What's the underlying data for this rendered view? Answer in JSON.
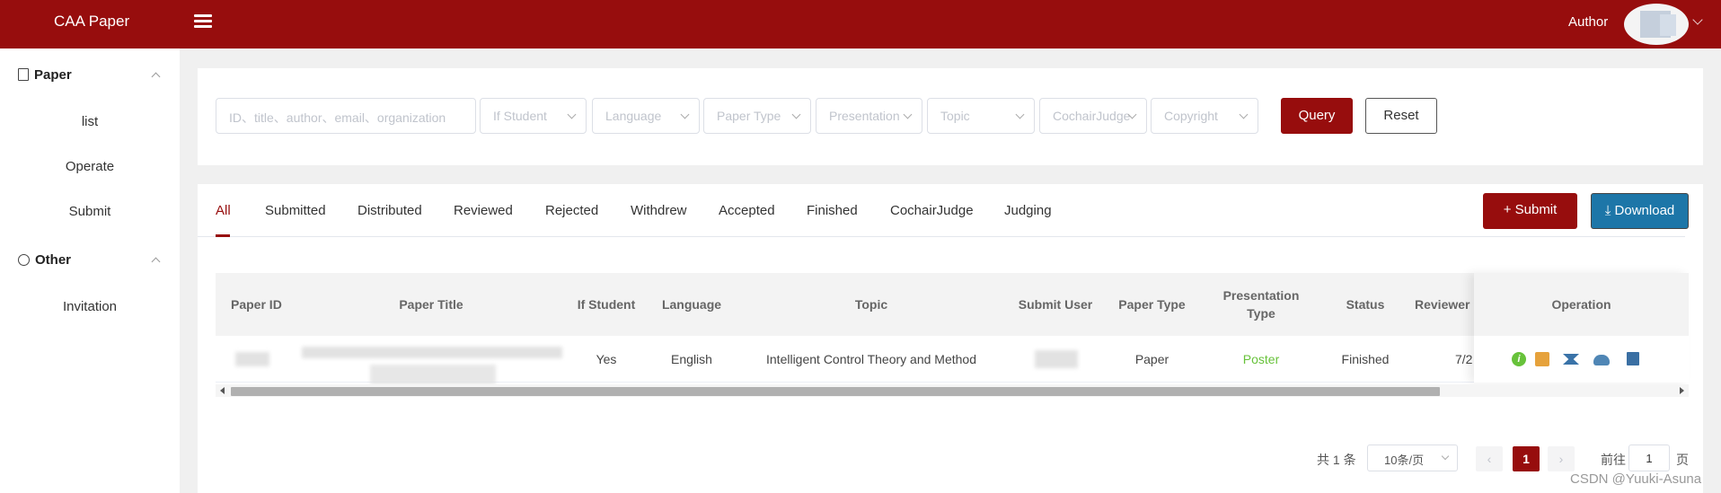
{
  "header": {
    "brand": "CAA Paper",
    "author_label": "Author"
  },
  "sidebar": {
    "groups": [
      {
        "title": "Paper",
        "icon": "document-icon",
        "items": [
          "list",
          "Operate",
          "Submit"
        ]
      },
      {
        "title": "Other",
        "icon": "smile-icon",
        "items": [
          "Invitation"
        ]
      }
    ]
  },
  "filters": {
    "search_placeholder": "ID、title、author、email、organization",
    "selects": [
      "If Student",
      "Language",
      "Paper Type",
      "Presentation",
      "Topic",
      "CochairJudge",
      "Copyright"
    ],
    "query_label": "Query",
    "reset_label": "Reset"
  },
  "tabs": [
    "All",
    "Submitted",
    "Distributed",
    "Reviewed",
    "Rejected",
    "Withdrew",
    "Accepted",
    "Finished",
    "CochairJudge",
    "Judging"
  ],
  "active_tab": "All",
  "actions": {
    "submit_label": "Submit",
    "download_label": "Download"
  },
  "table": {
    "columns": [
      "Paper ID",
      "Paper Title",
      "If Student",
      "Language",
      "Topic",
      "Submit User",
      "Paper Type",
      "Presentation Type",
      "Status",
      "Reviewer",
      "Operation"
    ],
    "rows": [
      {
        "if_student": "Yes",
        "language": "English",
        "topic": "Intelligent Control Theory and Method",
        "paper_type": "Paper",
        "presentation_type": "Poster",
        "status": "Finished",
        "reviewer": "7/2"
      }
    ],
    "operation_icons": [
      "info-icon",
      "clipboard-icon",
      "judge-icon",
      "cloud-upload-icon",
      "book-icon"
    ]
  },
  "pagination": {
    "total_text": "共 1 条",
    "page_size": "10条/页",
    "current_page": "1",
    "goto_label": "前往",
    "goto_value": "1",
    "goto_suffix": "页"
  },
  "watermark": "CSDN @Yuuki-Asuna",
  "colors": {
    "primary": "#970d0d",
    "download": "#1d76a8",
    "poster": "#67c23a"
  }
}
